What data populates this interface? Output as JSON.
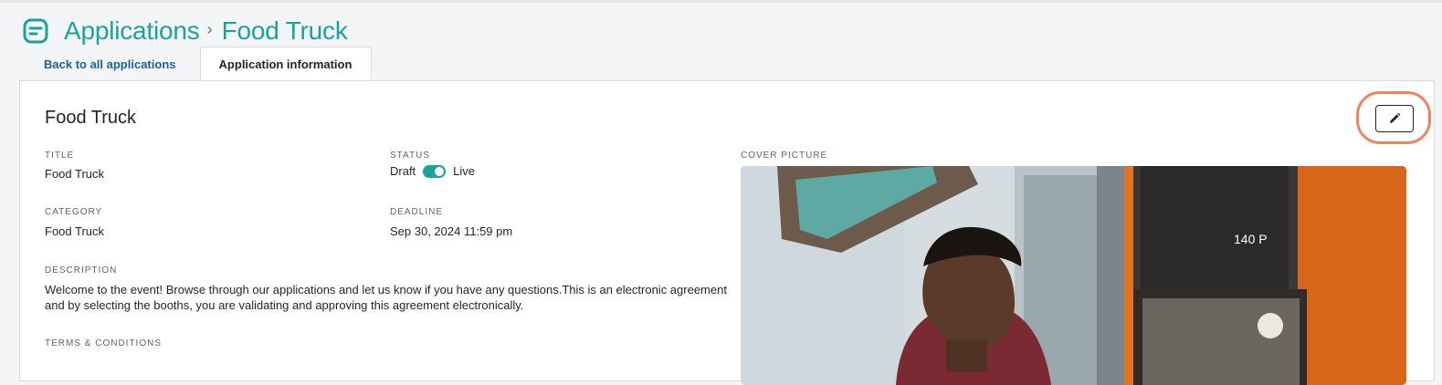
{
  "header": {
    "breadcrumb_root": "Applications",
    "breadcrumb_separator": "›",
    "breadcrumb_current": "Food Truck",
    "icon": "document-icon"
  },
  "tabs": {
    "back": "Back to all applications",
    "active": "Application information"
  },
  "card": {
    "title": "Food Truck",
    "edit_icon": "pencil-icon",
    "fields": {
      "title_label": "TITLE",
      "title_value": "Food Truck",
      "category_label": "CATEGORY",
      "category_value": "Food Truck",
      "status_label": "STATUS",
      "status_off": "Draft",
      "status_on": "Live",
      "status_is_live": true,
      "deadline_label": "DEADLINE",
      "deadline_value": "Sep 30, 2024 11:59 pm",
      "description_label": "DESCRIPTION",
      "description_value": "Welcome to the event! Browse through our applications and let us know if you have any questions.This is an electronic agreement and by selecting the booths, you are validating and approving this agreement electronically.",
      "terms_label": "TERMS & CONDITIONS",
      "cover_label": "COVER PICTURE"
    }
  },
  "colors": {
    "accent": "#1aa39b",
    "link": "#1f5f96",
    "highlight": "#f0835b"
  }
}
